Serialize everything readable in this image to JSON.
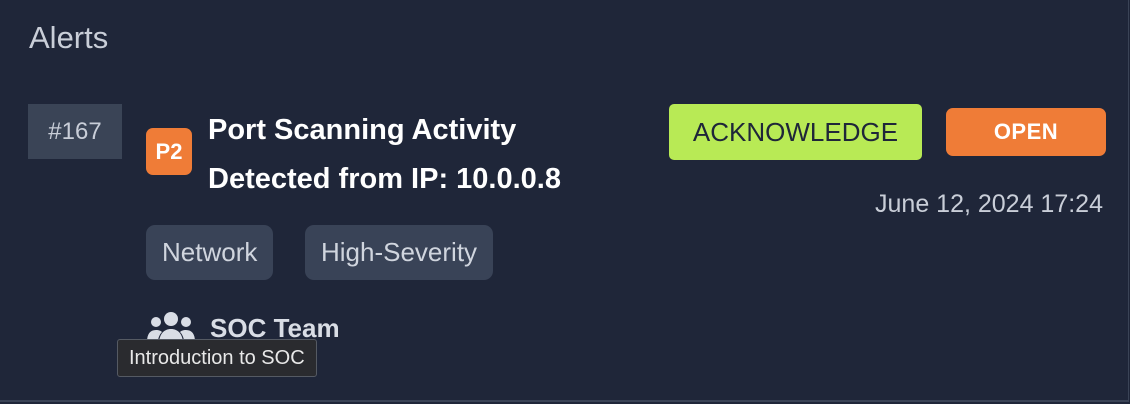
{
  "panel": {
    "title": "Alerts"
  },
  "alert": {
    "id": "#167",
    "priority": "P2",
    "title_line1": "Port Scanning Activity",
    "title_line2": "Detected from IP: 10.0.0.8",
    "acknowledge_label": "ACKNOWLEDGE",
    "status_label": "OPEN",
    "timestamp": "June 12, 2024 17:24",
    "tags": [
      "Network",
      "High-Severity"
    ],
    "team": {
      "icon": "users-icon",
      "label": "SOC Team"
    }
  },
  "tooltip": {
    "text": "Introduction to SOC"
  },
  "colors": {
    "background": "#1f2639",
    "acknowledge": "#b8ea55",
    "open": "#ef7c37",
    "priority": "#ef7c37",
    "tag_bg": "#394357"
  }
}
